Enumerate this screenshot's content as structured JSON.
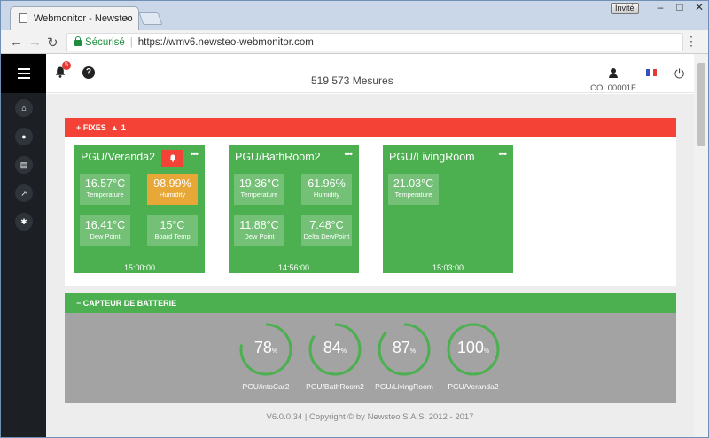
{
  "browser": {
    "tab_title": "Webmonitor - Newsteo",
    "invite_label": "Invité",
    "secure_label": "Sécurisé",
    "url": "https://wmv6.newsteo-webmonitor.com"
  },
  "topbar": {
    "notification_count": "5",
    "measures": "519 573 Mesures",
    "user_code": "COL00001F",
    "flag_colors": [
      "#3b4fb5",
      "#ffffff",
      "#e53935"
    ]
  },
  "sidebar": {
    "items": [
      "home-icon",
      "bell-icon",
      "document-icon",
      "trend-icon",
      "gear-icon"
    ]
  },
  "fixes": {
    "header": "+ FIXES",
    "alert_count": "1",
    "color": "#f44336",
    "cards": [
      {
        "title": "PGU/Veranda2",
        "alarm": true,
        "time": "15:00:00",
        "tiles": [
          {
            "value": "16.57°C",
            "label": "Temperature",
            "warn": false
          },
          {
            "value": "98.99%",
            "label": "Humidity",
            "warn": true
          },
          {
            "value": "16.41°C",
            "label": "Dew Point",
            "warn": false
          },
          {
            "value": "15°C",
            "label": "Board Temp",
            "warn": false
          }
        ]
      },
      {
        "title": "PGU/BathRoom2",
        "alarm": false,
        "time": "14:56:00",
        "tiles": [
          {
            "value": "19.36°C",
            "label": "Temperature",
            "warn": false
          },
          {
            "value": "61.96%",
            "label": "Humidity",
            "warn": false
          },
          {
            "value": "11.88°C",
            "label": "Dew Point",
            "warn": false
          },
          {
            "value": "7.48°C",
            "label": "Delta DewPoint",
            "warn": false
          }
        ]
      },
      {
        "title": "PGU/LivingRoom",
        "alarm": false,
        "time": "15:03:00",
        "tiles": [
          {
            "value": "21.03°C",
            "label": "Temperature",
            "warn": false
          }
        ]
      }
    ]
  },
  "battery": {
    "header": "− CAPTEUR DE BATTERIE",
    "color": "#4caf50",
    "gauges": [
      {
        "percent": 78,
        "value": "78",
        "unit": "%",
        "label": "PGU/intoCar2"
      },
      {
        "percent": 84,
        "value": "84",
        "unit": "%",
        "label": "PGU/BathRoom2"
      },
      {
        "percent": 87,
        "value": "87",
        "unit": "%",
        "label": "PGU/LivingRoom"
      },
      {
        "percent": 100,
        "value": "100",
        "unit": "%",
        "label": "PGU/Veranda2"
      }
    ]
  },
  "footer": "V6.0.0.34 | Copyright © by Newsteo S.A.S. 2012 - 2017"
}
